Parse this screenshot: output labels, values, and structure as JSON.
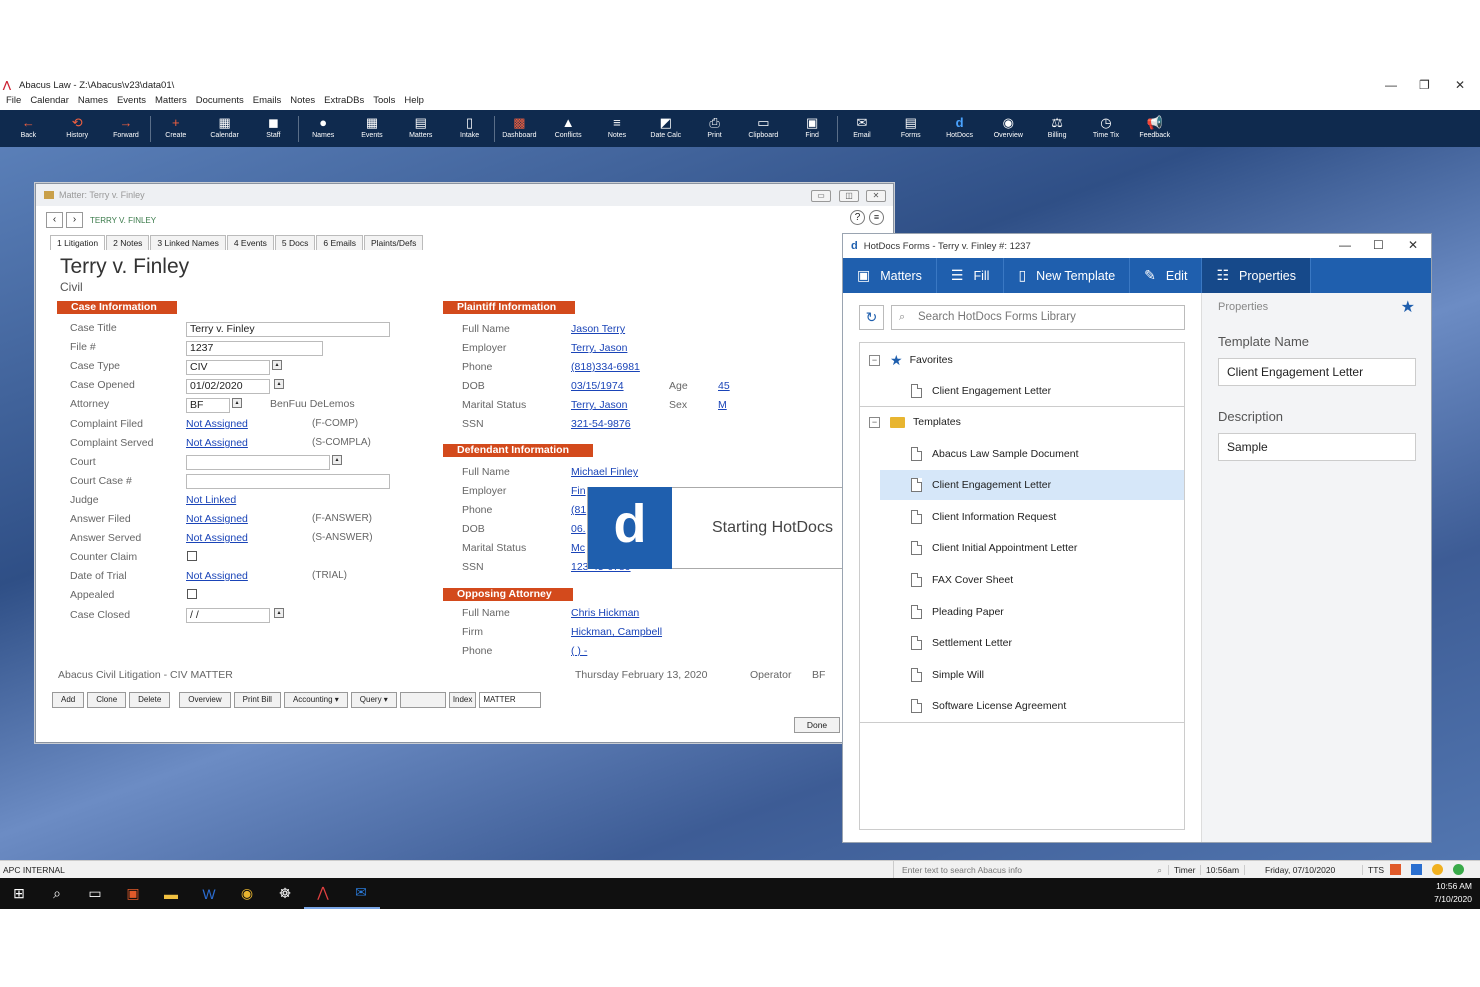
{
  "app": {
    "title": "Abacus Law - Z:\\Abacus\\v23\\data01\\"
  },
  "menu": [
    "File",
    "Calendar",
    "Names",
    "Events",
    "Matters",
    "Documents",
    "Emails",
    "Notes",
    "ExtraDBs",
    "Tools",
    "Help"
  ],
  "toolbar": [
    {
      "label": "Back",
      "icon": "←",
      "style": "red"
    },
    {
      "label": "History",
      "icon": "⟲",
      "style": "red"
    },
    {
      "label": "Forward",
      "icon": "→",
      "style": "red"
    },
    {
      "label": "Create",
      "icon": "+",
      "style": "red",
      "sep": true
    },
    {
      "label": "Calendar",
      "icon": "▦"
    },
    {
      "label": "Staff",
      "icon": "◼"
    },
    {
      "label": "Names",
      "icon": "●",
      "sep": true
    },
    {
      "label": "Events",
      "icon": "▦"
    },
    {
      "label": "Matters",
      "icon": "▤"
    },
    {
      "label": "Intake",
      "icon": "▯"
    },
    {
      "label": "Dashboard",
      "icon": "▩",
      "style": "red",
      "sep": true
    },
    {
      "label": "Conflicts",
      "icon": "▲"
    },
    {
      "label": "Notes",
      "icon": "≡"
    },
    {
      "label": "Date Calc",
      "icon": "◩"
    },
    {
      "label": "Print",
      "icon": "⎙"
    },
    {
      "label": "Clipboard",
      "icon": "▭"
    },
    {
      "label": "Find",
      "icon": "▣"
    },
    {
      "label": "Email",
      "icon": "✉",
      "sep": true
    },
    {
      "label": "Forms",
      "icon": "▤"
    },
    {
      "label": "HotDocs",
      "icon": "d",
      "style": "hd"
    },
    {
      "label": "Overview",
      "icon": "◉"
    },
    {
      "label": "Billing",
      "icon": "⚖"
    },
    {
      "label": "Time Tix",
      "icon": "◷"
    },
    {
      "label": "Feedback",
      "icon": "📢"
    }
  ],
  "matter_window": {
    "title": "Matter: Terry v. Finley",
    "nav_name": "TERRY V. FINLEY",
    "tabs": [
      "1 Litigation",
      "2 Notes",
      "3 Linked Names",
      "4 Events",
      "5 Docs",
      "6 Emails",
      "Plaints/Defs"
    ],
    "case_title": "Terry v. Finley",
    "case_type_label": "Civil",
    "case_info": {
      "header": "Case Information",
      "labels": [
        "Case Title",
        "File #",
        "Case Type",
        "Case Opened",
        "Attorney",
        "Complaint Filed",
        "Complaint Served",
        "Court",
        "Court Case #",
        "Judge",
        "Answer Filed",
        "Answer Served",
        "Counter Claim",
        "Date of Trial",
        "Appealed",
        "Case Closed"
      ],
      "case_title_val": "Terry v. Finley",
      "file_no": "1237",
      "case_type": "CIV",
      "case_opened": "01/02/2020",
      "attorney_code": "BF",
      "attorney_name": "BenFuu DeLemos",
      "complaint_filed": "Not Assigned",
      "complaint_filed_code": "(F-COMP)",
      "complaint_served": "Not Assigned",
      "complaint_served_code": "(S-COMPLA)",
      "judge": "Not Linked",
      "answer_filed": "Not Assigned",
      "answer_filed_code": "(F-ANSWER)",
      "answer_served": "Not Assigned",
      "answer_served_code": "(S-ANSWER)",
      "date_of_trial": "Not Assigned",
      "date_of_trial_code": "(TRIAL)",
      "case_closed": " /  /"
    },
    "plaintiff": {
      "header": "Plaintiff Information",
      "labels": [
        "Full Name",
        "Employer",
        "Phone",
        "DOB",
        "Marital Status",
        "SSN"
      ],
      "full_name": "Jason Terry",
      "employer": "Terry, Jason",
      "phone": "(818)334-6981",
      "dob": "03/15/1974",
      "age_label": "Age",
      "age": "45",
      "marital": "Terry, Jason",
      "sex_label": "Sex",
      "sex": "M",
      "ssn": "321-54-9876"
    },
    "defendant": {
      "header": "Defendant Information",
      "labels": [
        "Full Name",
        "Employer",
        "Phone",
        "DOB",
        "Marital Status",
        "SSN"
      ],
      "full_name": "Michael Finley",
      "employer": "Fin",
      "phone": "(81",
      "dob": "06.",
      "marital": "Mc",
      "ssn": "123-45-6789"
    },
    "opposing": {
      "header": "Opposing Attorney",
      "labels": [
        "Full Name",
        "Firm",
        "Phone"
      ],
      "full_name": "Chris Hickman",
      "firm": "Hickman, Campbell",
      "phone": "(  )  -"
    },
    "footer_left": "Abacus Civil Litigation - CIV MATTER",
    "footer_date": "Thursday  February 13, 2020",
    "footer_operator_label": "Operator",
    "footer_operator": "BF",
    "buttons": [
      "Add",
      "Clone",
      "Delete",
      "Overview",
      "Print Bill",
      "Accounting ▾",
      "Query ▾"
    ],
    "index_label": "Index",
    "index_value": "MATTER",
    "done": "Done"
  },
  "splash": {
    "logo": "d",
    "text": "Starting HotDocs"
  },
  "hotdocs": {
    "title": "HotDocs Forms  -  Terry v. Finley #: 1237",
    "ribbon": [
      {
        "label": "Matters",
        "icon": "▣"
      },
      {
        "label": "Fill",
        "icon": "☰"
      },
      {
        "label": "New Template",
        "icon": "▯"
      },
      {
        "label": "Edit",
        "icon": "✎"
      },
      {
        "label": "Properties",
        "icon": "☷",
        "active": true
      }
    ],
    "search_placeholder": "Search HotDocs Forms Library",
    "favorites_label": "Favorites",
    "favorites": [
      "Client Engagement Letter"
    ],
    "templates_label": "Templates",
    "templates": [
      "Abacus Law Sample Document",
      "Client Engagement Letter",
      "Client Information Request",
      "Client Initial Appointment Letter",
      "FAX Cover Sheet",
      "Pleading Paper",
      "Settlement Letter",
      "Simple Will",
      "Software License Agreement"
    ],
    "selected_index": 1,
    "properties": {
      "header": "Properties",
      "template_name_label": "Template Name",
      "template_name": "Client Engagement Letter",
      "description_label": "Description",
      "description": "Sample"
    }
  },
  "statusbar": {
    "left": "APC INTERNAL",
    "search_placeholder": "Enter text to search Abacus info",
    "timer": "Timer",
    "time": "10:56am",
    "date": "Friday, 07/10/2020",
    "tts": "TTS"
  },
  "taskbar": {
    "clock_time": "10:56 AM",
    "clock_date": "7/10/2020"
  }
}
